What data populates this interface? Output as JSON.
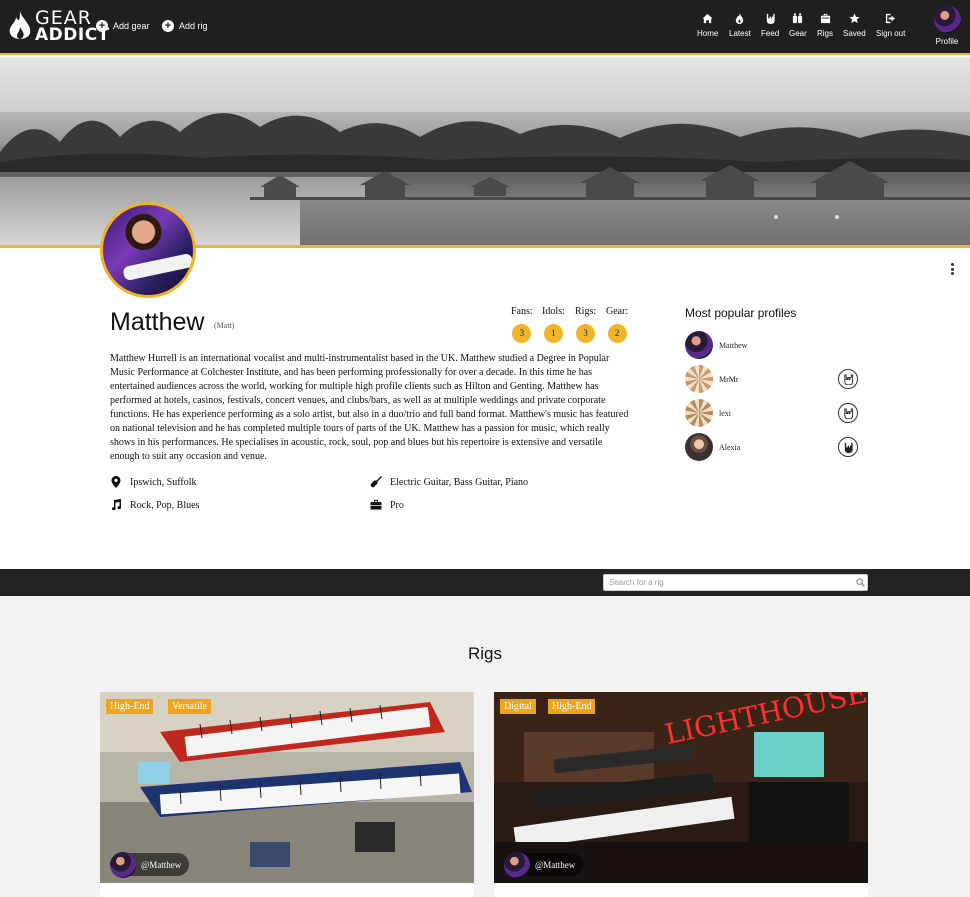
{
  "brand": {
    "line1": "GEAR",
    "line2": "ADDICT"
  },
  "header_actions": {
    "add_gear": "Add gear",
    "add_rig": "Add rig"
  },
  "nav": [
    {
      "label": "Home",
      "icon": "home-icon"
    },
    {
      "label": "Latest",
      "icon": "flame-icon"
    },
    {
      "label": "Feed",
      "icon": "rock-hand-icon"
    },
    {
      "label": "Gear",
      "icon": "gear-amps-icon"
    },
    {
      "label": "Rigs",
      "icon": "case-icon"
    },
    {
      "label": "Saved",
      "icon": "star-icon"
    },
    {
      "label": "Sign out",
      "icon": "sign-out-icon"
    }
  ],
  "profile_nav_label": "Profile",
  "profile": {
    "name": "Matthew",
    "nickname": "(Matt)",
    "bio": "Matthew Hurrell is an international vocalist and multi-instrumentalist based in the UK. Matthew studied a Degree in Popular Music Performance at Colchester Institute, and has been performing professionally for over a decade.  In this time he has entertained audiences across the world, working for multiple high profile clients such as Hilton and Genting. Matthew has performed at hotels, casinos, festivals, concert venues, and clubs/bars, as well as at multiple weddings and private corporate functions.  He has experience performing as a solo artist, but also in a duo/trio and full band format. Matthew's music has featured on national television and he has completed multiple tours of parts of the UK. Matthew has a passion for music, which really shows in his performances. He specialises in acoustic, rock, soul, pop and blues but his repertoire is extensive and versatile enough to suit any occasion and venue.",
    "location": "Ipswich, Suffolk",
    "instruments": "Electric Guitar, Bass Guitar, Piano",
    "genres": "Rock, Pop, Blues",
    "level": "Pro"
  },
  "stats": [
    {
      "label": "Fans:",
      "value": "3"
    },
    {
      "label": "Idols:",
      "value": "1"
    },
    {
      "label": "Rigs:",
      "value": "3"
    },
    {
      "label": "Gear:",
      "value": "2"
    }
  ],
  "popular": {
    "title": "Most popular profiles",
    "items": [
      {
        "name": "Matthew",
        "has_button": false
      },
      {
        "name": "MrMr",
        "has_button": true
      },
      {
        "name": "lexi",
        "has_button": true
      },
      {
        "name": "Alexia",
        "has_button": true
      }
    ]
  },
  "search": {
    "placeholder": "Search for a rig"
  },
  "rigs": {
    "title": "Rigs",
    "cards": [
      {
        "tags": [
          "High-End",
          "Versatile"
        ],
        "owner": "@Matthew"
      },
      {
        "tags": [
          "Digital",
          "High-End"
        ],
        "owner": "@Matthew"
      }
    ]
  },
  "colors": {
    "accent": "#f0b429",
    "tag": "#f0a41c",
    "topbar": "#1f1f1f"
  }
}
